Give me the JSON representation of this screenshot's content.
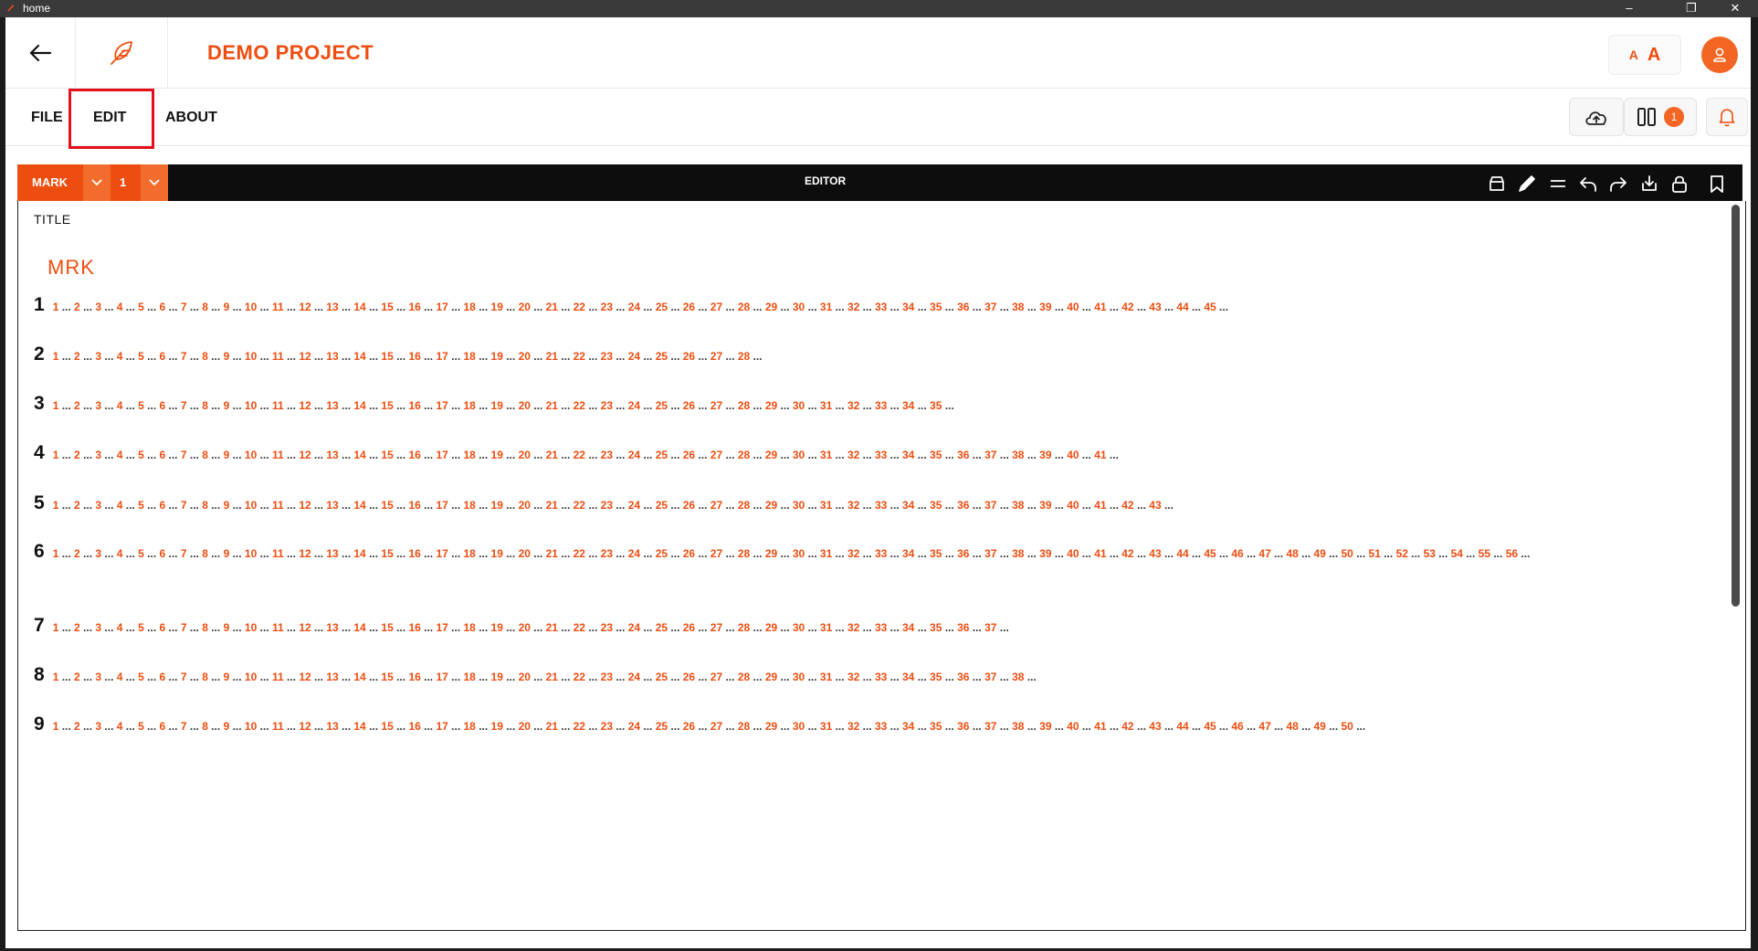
{
  "window": {
    "title": "home"
  },
  "header": {
    "project_title": "DEMO PROJECT",
    "font_small": "A",
    "font_large": "A"
  },
  "menu": {
    "file": "FILE",
    "edit": "EDIT",
    "about": "ABOUT"
  },
  "toolbar": {
    "notification_count": "1"
  },
  "editor": {
    "mark_label": "MARK",
    "mark_number": "1",
    "title": "EDITOR"
  },
  "document": {
    "title_label": "TITLE",
    "title_value": "MRK",
    "separator": "...",
    "verses": [
      {
        "number": "1",
        "marks": 45
      },
      {
        "number": "2",
        "marks": 28
      },
      {
        "number": "3",
        "marks": 35
      },
      {
        "number": "4",
        "marks": 41
      },
      {
        "number": "5",
        "marks": 43
      },
      {
        "number": "6",
        "marks": 56
      },
      {
        "number": "7",
        "marks": 37
      },
      {
        "number": "8",
        "marks": 38
      },
      {
        "number": "9",
        "marks": 50
      }
    ]
  },
  "colors": {
    "accent": "#ee4d10",
    "highlight": "#e3101b",
    "bar": "#0d0d0d"
  }
}
